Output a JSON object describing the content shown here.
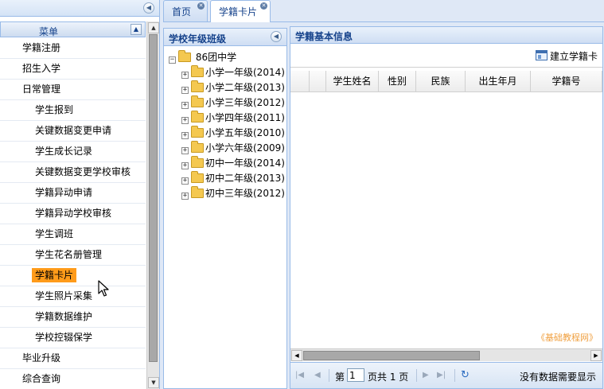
{
  "left_menu": {
    "title": "菜单",
    "items": [
      {
        "label": "学籍注册",
        "level": 0,
        "active": false
      },
      {
        "label": "招生入学",
        "level": 0,
        "active": false
      },
      {
        "label": "日常管理",
        "level": 0,
        "active": false
      },
      {
        "label": "学生报到",
        "level": 1,
        "active": false
      },
      {
        "label": "关键数据变更申请",
        "level": 1,
        "active": false
      },
      {
        "label": "学生成长记录",
        "level": 1,
        "active": false
      },
      {
        "label": "关键数据变更学校审核",
        "level": 1,
        "active": false
      },
      {
        "label": "学籍异动申请",
        "level": 1,
        "active": false
      },
      {
        "label": "学籍异动学校审核",
        "level": 1,
        "active": false
      },
      {
        "label": "学生调班",
        "level": 1,
        "active": false
      },
      {
        "label": "学生花名册管理",
        "level": 1,
        "active": false
      },
      {
        "label": "学籍卡片",
        "level": 1,
        "active": true
      },
      {
        "label": "学生照片采集",
        "level": 1,
        "active": false
      },
      {
        "label": "学籍数据维护",
        "level": 1,
        "active": false
      },
      {
        "label": "学校控辍保学",
        "level": 1,
        "active": false
      },
      {
        "label": "毕业升级",
        "level": 0,
        "active": false
      },
      {
        "label": "综合查询",
        "level": 0,
        "active": false
      }
    ]
  },
  "tabs": [
    {
      "label": "首页",
      "active": false
    },
    {
      "label": "学籍卡片",
      "active": true
    }
  ],
  "tree_panel": {
    "title": "学校年级班级",
    "root": "86团中学",
    "nodes": [
      "小学一年级(2014)",
      "小学二年级(2013)",
      "小学三年级(2012)",
      "小学四年级(2011)",
      "小学五年级(2010)",
      "小学六年级(2009)",
      "初中一年级(2014)",
      "初中二年级(2013)",
      "初中三年级(2012)"
    ]
  },
  "main_panel": {
    "title": "学籍基本信息",
    "toolbar": {
      "build_label": "建立学籍卡"
    },
    "columns": [
      "",
      "",
      "学生姓名",
      "性别",
      "民族",
      "出生年月",
      "学籍号"
    ],
    "watermark": "《基础教程网》",
    "pager": {
      "page_prefix": "第",
      "page_value": "1",
      "page_suffix": "页共 1 页",
      "status": "没有数据需要显示"
    }
  },
  "colors": {
    "panel_border": "#99bbe8",
    "header_text": "#15428b",
    "active_highlight": "#ff9b1a"
  }
}
